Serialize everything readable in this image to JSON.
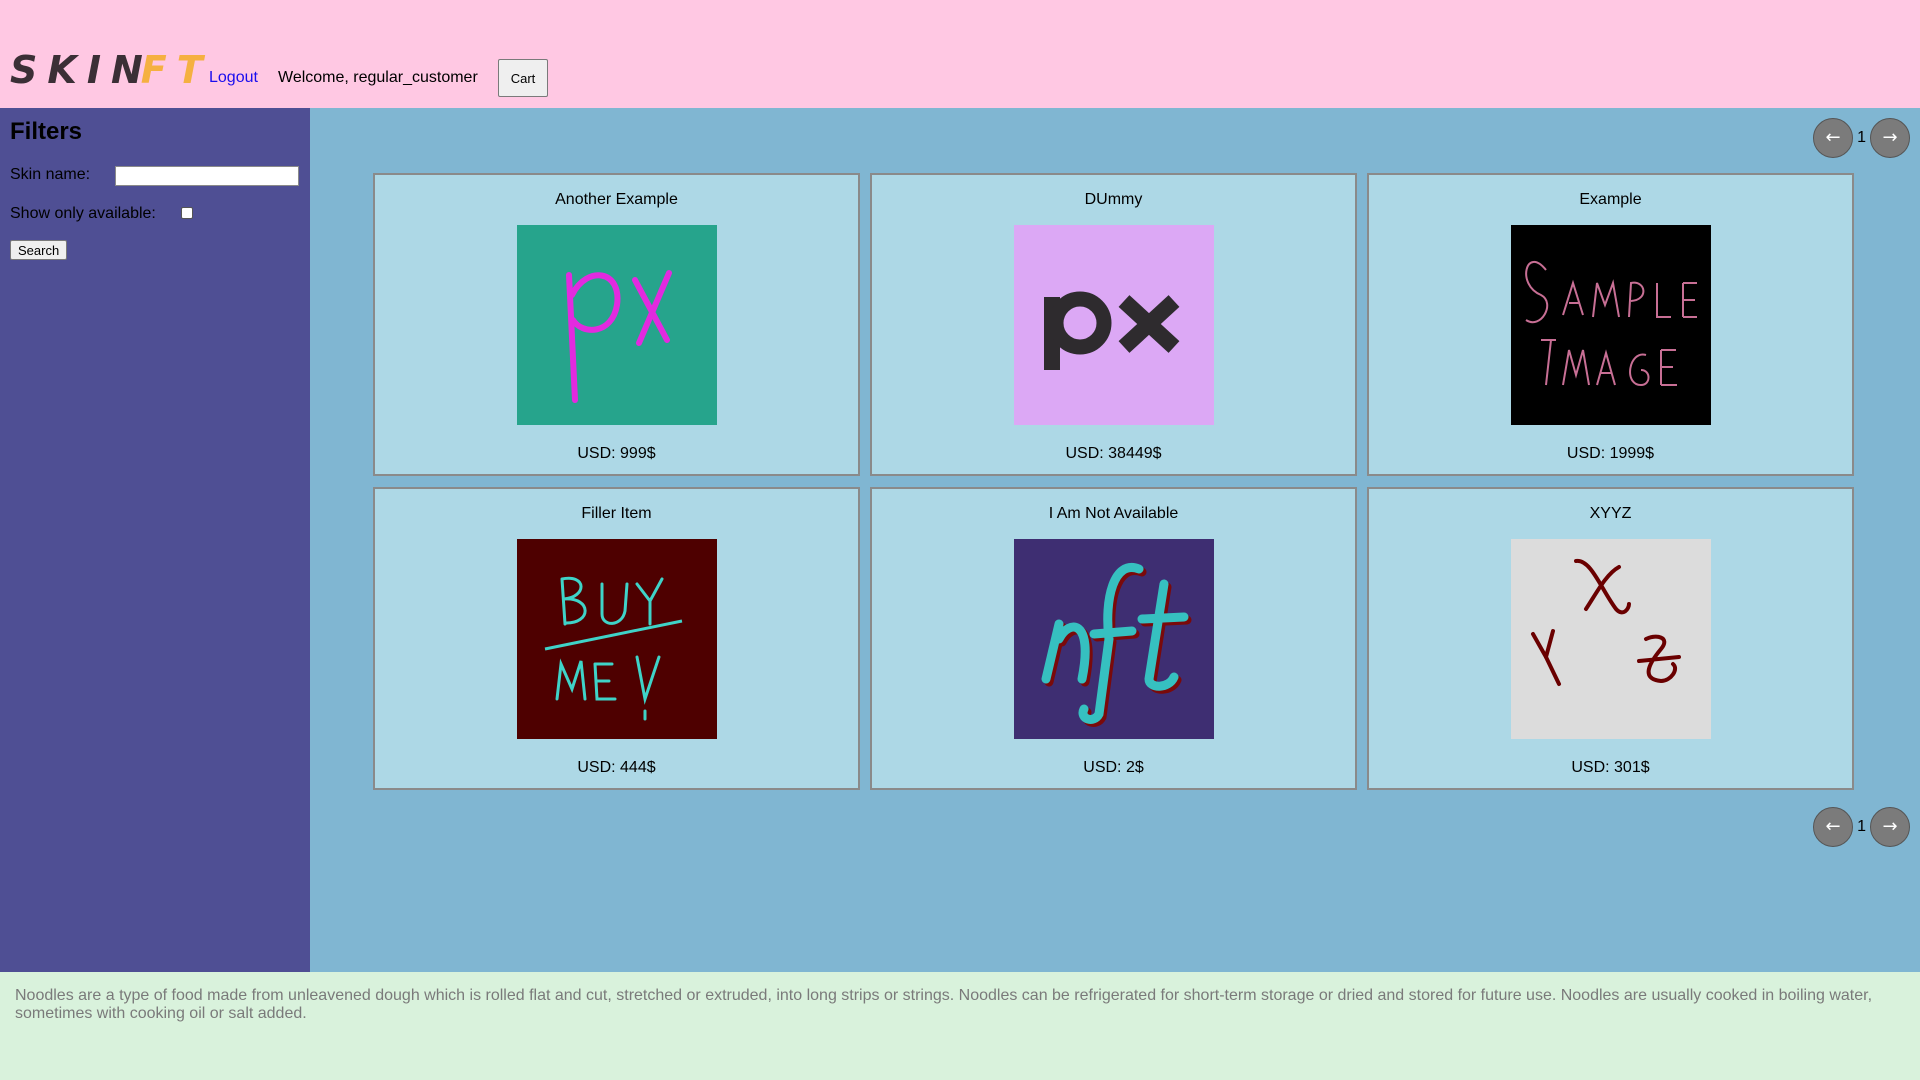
{
  "header": {
    "logo_part1": "SKIN",
    "logo_part2": "FT",
    "logout_label": "Logout",
    "welcome_text": "Welcome, regular_customer",
    "cart_label": "Cart"
  },
  "sidebar": {
    "title": "Filters",
    "skin_name_label": "Skin name:",
    "skin_name_value": "",
    "show_available_label": "Show only available:",
    "show_available_checked": false,
    "search_label": "Search"
  },
  "pagination": {
    "prev_label": "←",
    "next_label": "→",
    "current_page": "1"
  },
  "products": [
    {
      "title": "Another Example",
      "image_text": "px",
      "price": "USD: 999$",
      "colors": {
        "bg": "#26a48c",
        "fg": "#e22adf"
      }
    },
    {
      "title": "DUmmy",
      "image_text": "px",
      "price": "USD: 38449$",
      "colors": {
        "bg": "#dca8f5",
        "fg": "#2e2b2e"
      }
    },
    {
      "title": "Example",
      "image_text": "SAMPLE IMAGE",
      "price": "USD: 1999$",
      "colors": {
        "bg": "#000000",
        "fg": "#c86f95"
      }
    },
    {
      "title": "Filler Item",
      "image_text": "BUY ME!",
      "price": "USD: 444$",
      "colors": {
        "bg": "#4e0000",
        "fg": "#3fd3c8"
      }
    },
    {
      "title": "I Am Not Available",
      "image_text": "nft",
      "price": "USD: 2$",
      "colors": {
        "bg": "#3e2e72",
        "fg": "#36c0c0"
      }
    },
    {
      "title": "XYYZ",
      "image_text": "X Y Z",
      "price": "USD: 301$",
      "colors": {
        "bg": "#dcdcdc",
        "fg": "#6a0000"
      }
    }
  ],
  "footer": {
    "text": "Noodles are a type of food made from unleavened dough which is rolled flat and cut, stretched or extruded, into long strips or strings. Noodles can be refrigerated for short-term storage or dried and stored for future use. Noodles are usually cooked in boiling water, sometimes with cooking oil or salt added."
  }
}
